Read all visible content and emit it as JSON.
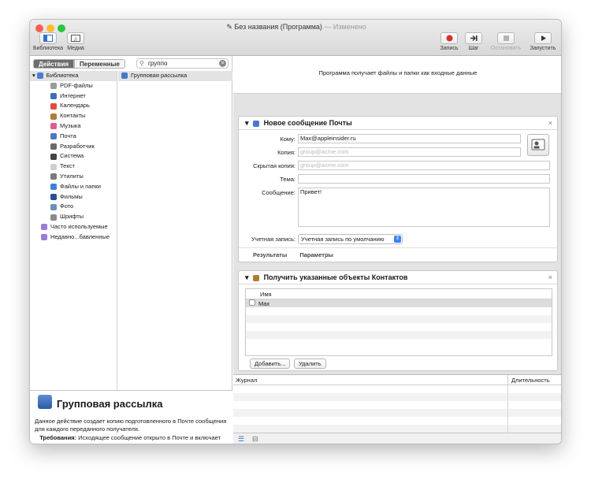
{
  "window": {
    "title": "Без названия (Программа)",
    "title_suffix": "— Изменено"
  },
  "toolbar": {
    "library_label": "Библиотека",
    "media_label": "Медиа",
    "record_label": "Запись",
    "step_label": "Шаг",
    "stop_label": "Остановить",
    "run_label": "Запустить"
  },
  "left": {
    "tab_actions": "Действия",
    "tab_variables": "Переменные",
    "search_value": "группо",
    "library": [
      {
        "label": "Библиотека",
        "icon": "library-icon",
        "color": "#4a7fd4"
      },
      {
        "label": "PDF-файлы",
        "icon": "pdf-icon",
        "color": "#9a9a9a"
      },
      {
        "label": "Интернет",
        "icon": "internet-icon",
        "color": "#3b6fb8"
      },
      {
        "label": "Календарь",
        "icon": "calendar-icon",
        "color": "#e14b3b"
      },
      {
        "label": "Контакты",
        "icon": "contacts-icon",
        "color": "#b07a3a"
      },
      {
        "label": "Музыка",
        "icon": "music-icon",
        "color": "#e25a8a"
      },
      {
        "label": "Почта",
        "icon": "mail-icon",
        "color": "#4a78c8"
      },
      {
        "label": "Разработчик",
        "icon": "developer-icon",
        "color": "#6b6b6b"
      },
      {
        "label": "Система",
        "icon": "system-icon",
        "color": "#444444"
      },
      {
        "label": "Текст",
        "icon": "text-icon",
        "color": "#cfcfcf"
      },
      {
        "label": "Утилиты",
        "icon": "utilities-icon",
        "color": "#7a7a7a"
      },
      {
        "label": "Файлы и папки",
        "icon": "folders-icon",
        "color": "#3b82d8"
      },
      {
        "label": "Фильмы",
        "icon": "movies-icon",
        "color": "#2b4f92"
      },
      {
        "label": "Фото",
        "icon": "photos-icon",
        "color": "#6b8fb5"
      },
      {
        "label": "Шрифты",
        "icon": "fonts-icon",
        "color": "#8a8a8a"
      },
      {
        "label": "Часто используемые",
        "icon": "smart-folder-icon",
        "color": "#9b7bd8"
      },
      {
        "label": "Недавно...бавленные",
        "icon": "smart-folder-icon",
        "color": "#9b7bd8"
      }
    ],
    "action_item": "Групповая рассылка",
    "description": {
      "title": "Групповая рассылка",
      "text": "Данное действие создает копию подготовленного в Почте сообщения для каждого переданного получателя.",
      "requirements_label": "Требования:",
      "requirements_text": "Исходящее сообщение открыто в Почте и включает тему, содержимое и все"
    }
  },
  "workflow": {
    "input_text": "Программа получает файлы и папки как входные данные",
    "mail_card": {
      "title": "Новое сообщение Почты",
      "to_label": "Кому:",
      "to_value": "Max@appleinsider.ru",
      "cc_label": "Копия:",
      "cc_placeholder": "group@acme.com",
      "bcc_label": "Скрытая копия:",
      "bcc_placeholder": "group@acme.com",
      "subject_label": "Тема:",
      "message_label": "Сообщение:",
      "message_value": "Привет!",
      "account_label": "Учетная запись:",
      "account_value": "Учетная запись по умолчанию",
      "results_tab": "Результаты",
      "options_tab": "Параметры"
    },
    "contacts_card": {
      "title": "Получить указанные объекты Контактов",
      "column_name": "Имя",
      "rows": [
        "Max"
      ],
      "add_button": "Добавить...",
      "delete_button": "Удалить"
    },
    "log": {
      "col_log": "Журнал",
      "col_duration": "Длительность"
    }
  },
  "colors": {
    "close": "#fe5f57",
    "minimize": "#febc2e",
    "zoom": "#28c840",
    "record": "#d0332b",
    "selection": "#dcdcdc"
  }
}
